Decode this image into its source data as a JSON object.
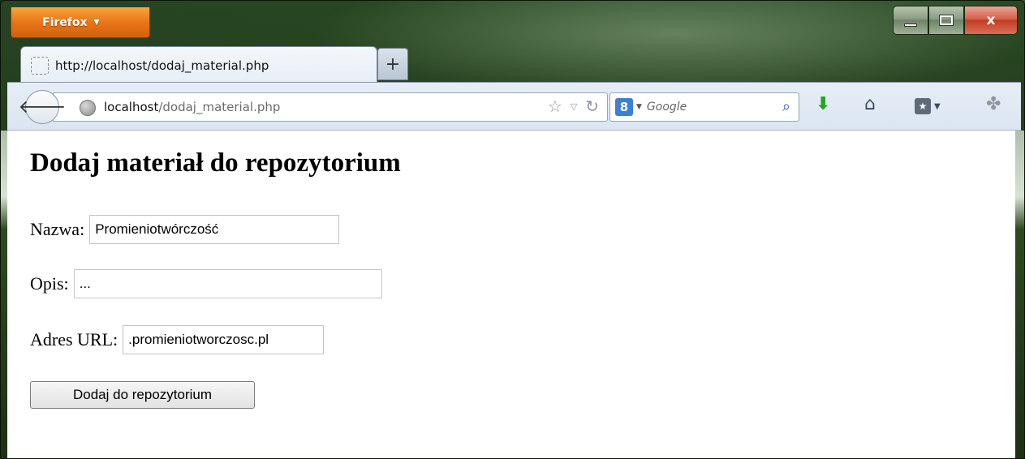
{
  "browser": {
    "app_button_label": "Firefox",
    "window_controls": {
      "minimize": "",
      "maximize": "",
      "close": "x"
    }
  },
  "tab": {
    "title": "http://localhost/dodaj_material.php",
    "new_tab_label": "+"
  },
  "toolbar": {
    "url_host": "localhost",
    "url_path": "/dodaj_material.php",
    "search_placeholder": "Google",
    "search_engine_badge": "8"
  },
  "page": {
    "title": "Dodaj materiał do repozytorium",
    "fields": {
      "nazwa": {
        "label": "Nazwa:",
        "value": "Promieniotwórczość"
      },
      "opis": {
        "label": "Opis:",
        "value": "..."
      },
      "url": {
        "label": "Adres URL:",
        "value": ".promieniotworczosc.pl"
      }
    },
    "submit_label": "Dodaj do repozytorium"
  },
  "icons": {
    "back": "back-arrow-icon",
    "site_identity": "globe-icon",
    "bookmark_star": "star-icon",
    "history_dropdown": "dropdown-icon",
    "reload": "reload-icon",
    "search": "magnifier-icon",
    "downloads": "download-arrow-icon",
    "home": "home-icon",
    "bookmarks": "bookmarks-icon",
    "addons": "addons-icon"
  },
  "colors": {
    "firefox_button": "#e8761a",
    "close_button": "#c13d23",
    "download_arrow": "#23a524"
  }
}
